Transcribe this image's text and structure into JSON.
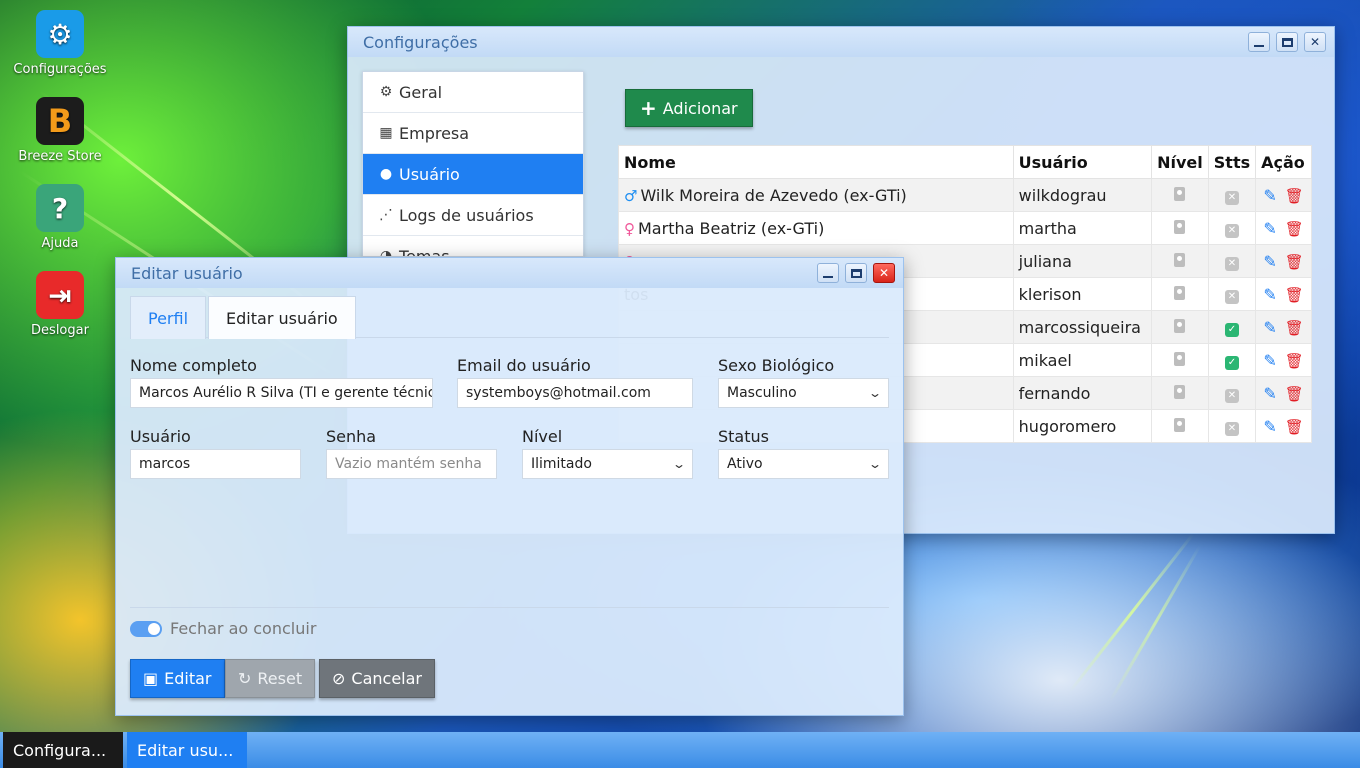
{
  "desktop": {
    "icons": [
      {
        "label": "Configurações",
        "icon": "gear-icon",
        "color": "#1a9be8"
      },
      {
        "label": "Breeze Store",
        "icon": "store-icon",
        "color": "#f29a1a"
      },
      {
        "label": "Ajuda",
        "icon": "help-icon",
        "color": "#3aa57a"
      },
      {
        "label": "Deslogar",
        "icon": "logout-icon",
        "color": "#e82a2a"
      }
    ]
  },
  "config_window": {
    "title": "Configurações",
    "menu": [
      {
        "label": "Geral",
        "icon": "gear-icon"
      },
      {
        "label": "Empresa",
        "icon": "building-icon"
      },
      {
        "label": "Usuário",
        "icon": "user-icon",
        "active": true
      },
      {
        "label": "Logs de usuários",
        "icon": "footprints-icon"
      },
      {
        "label": "Temas",
        "icon": "palette-icon"
      }
    ],
    "add_button": "Adicionar",
    "table": {
      "headers": [
        "Nome",
        "Usuário",
        "Nível",
        "Stts",
        "Ação"
      ],
      "rows": [
        {
          "name": "Wilk Moreira de Azevedo (ex-GTi)",
          "gender": "male",
          "user": "wilkdograu",
          "status": "inactive"
        },
        {
          "name": "Martha Beatriz (ex-GTi)",
          "gender": "female",
          "user": "martha",
          "status": "inactive"
        },
        {
          "name": "",
          "gender": "female",
          "user": "juliana",
          "status": "inactive"
        },
        {
          "name": "tos",
          "gender": "",
          "user": "klerison",
          "status": "inactive"
        },
        {
          "name": "",
          "gender": "",
          "user": "marcossiqueira",
          "status": "active"
        },
        {
          "name": "",
          "gender": "",
          "user": "mikael",
          "status": "active"
        },
        {
          "name": "",
          "gender": "",
          "user": "fernando",
          "status": "inactive"
        },
        {
          "name": "",
          "gender": "",
          "user": "hugoromero",
          "status": "inactive"
        }
      ]
    }
  },
  "edit_window": {
    "title": "Editar usuário",
    "tabs": [
      "Perfil",
      "Editar usuário"
    ],
    "fields": {
      "full_name": {
        "label": "Nome completo",
        "value": "Marcos Aurélio R Silva (TI e gerente técnico)"
      },
      "email": {
        "label": "Email do usuário",
        "value": "systemboys@hotmail.com"
      },
      "sex": {
        "label": "Sexo Biológico",
        "value": "Masculino"
      },
      "username": {
        "label": "Usuário",
        "value": "marcos"
      },
      "password": {
        "label": "Senha",
        "placeholder": "Vazio mantém senha"
      },
      "level": {
        "label": "Nível",
        "value": "Ilimitado"
      },
      "status": {
        "label": "Status",
        "value": "Ativo"
      }
    },
    "close_on_finish": {
      "label": "Fechar ao concluir",
      "checked": true
    },
    "buttons": {
      "edit": "Editar",
      "reset": "Reset",
      "cancel": "Cancelar"
    }
  },
  "taskbar": {
    "items": [
      "Configura...",
      "Editar usu..."
    ]
  }
}
